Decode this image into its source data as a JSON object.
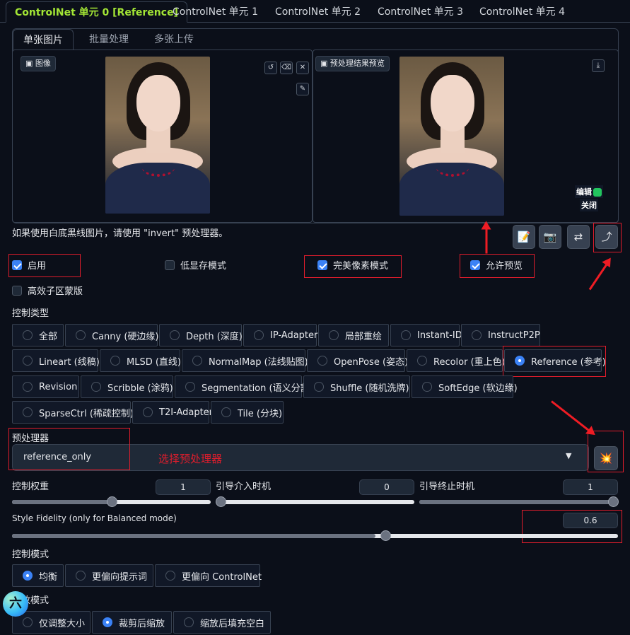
{
  "unit_tabs": [
    "ControlNet 单元 0 [Reference]",
    "ControlNet 单元 1",
    "ControlNet 单元 2",
    "ControlNet 单元 3",
    "ControlNet 单元 4"
  ],
  "input_tabs": [
    "单张图片",
    "批量处理",
    "多张上传"
  ],
  "image_label": "图像",
  "preview_label": "预处理结果预览",
  "edit_label": "编辑",
  "close_label": "关闭",
  "hint": "如果使用白底黑线图片，请使用 \"invert\" 预处理器。",
  "checkboxes": {
    "enable": {
      "label": "启用",
      "checked": true
    },
    "low_vram": {
      "label": "低显存模式",
      "checked": false
    },
    "pixel_perfect": {
      "label": "完美像素模式",
      "checked": true
    },
    "allow_preview": {
      "label": "允许预览",
      "checked": true
    },
    "effective_mask": {
      "label": "高效子区蒙版",
      "checked": false
    }
  },
  "control_type": {
    "title": "控制类型",
    "options": [
      "全部",
      "Canny (硬边缘)",
      "Depth (深度)",
      "IP-Adapter",
      "局部重绘",
      "Instant-ID",
      "InstructP2P",
      "Lineart (线稿)",
      "MLSD (直线)",
      "NormalMap (法线贴图)",
      "OpenPose (姿态)",
      "Recolor (重上色)",
      "Reference (参考)",
      "Revision",
      "Scribble (涂鸦)",
      "Segmentation (语义分割)",
      "Shuffle (随机洗牌)",
      "SoftEdge (软边缘)",
      "SparseCtrl (稀疏控制)",
      "T2I-Adapter",
      "Tile (分块)"
    ],
    "selected": "Reference (参考)"
  },
  "preprocessor": {
    "title": "预处理器",
    "value": "reference_only",
    "annotation": "选择预处理器"
  },
  "sliders": {
    "weight": {
      "label": "控制权重",
      "value": "1"
    },
    "start": {
      "label": "引导介入时机",
      "value": "0"
    },
    "end": {
      "label": "引导终止时机",
      "value": "1"
    },
    "fidelity": {
      "label": "Style Fidelity (only for Balanced mode)",
      "value": "0.6"
    }
  },
  "control_mode": {
    "title": "控制模式",
    "options": [
      "均衡",
      "更偏向提示词",
      "更偏向 ControlNet"
    ],
    "selected": "均衡"
  },
  "resize_mode": {
    "title": "缩放模式",
    "options": [
      "仅调整大小",
      "裁剪后缩放",
      "缩放后填充空白"
    ],
    "selected": "裁剪后缩放"
  },
  "floating_badge": "六",
  "colors": {
    "accent": "#a3e635",
    "annotation_red": "#e11d2c",
    "primary": "#3b82f6"
  }
}
